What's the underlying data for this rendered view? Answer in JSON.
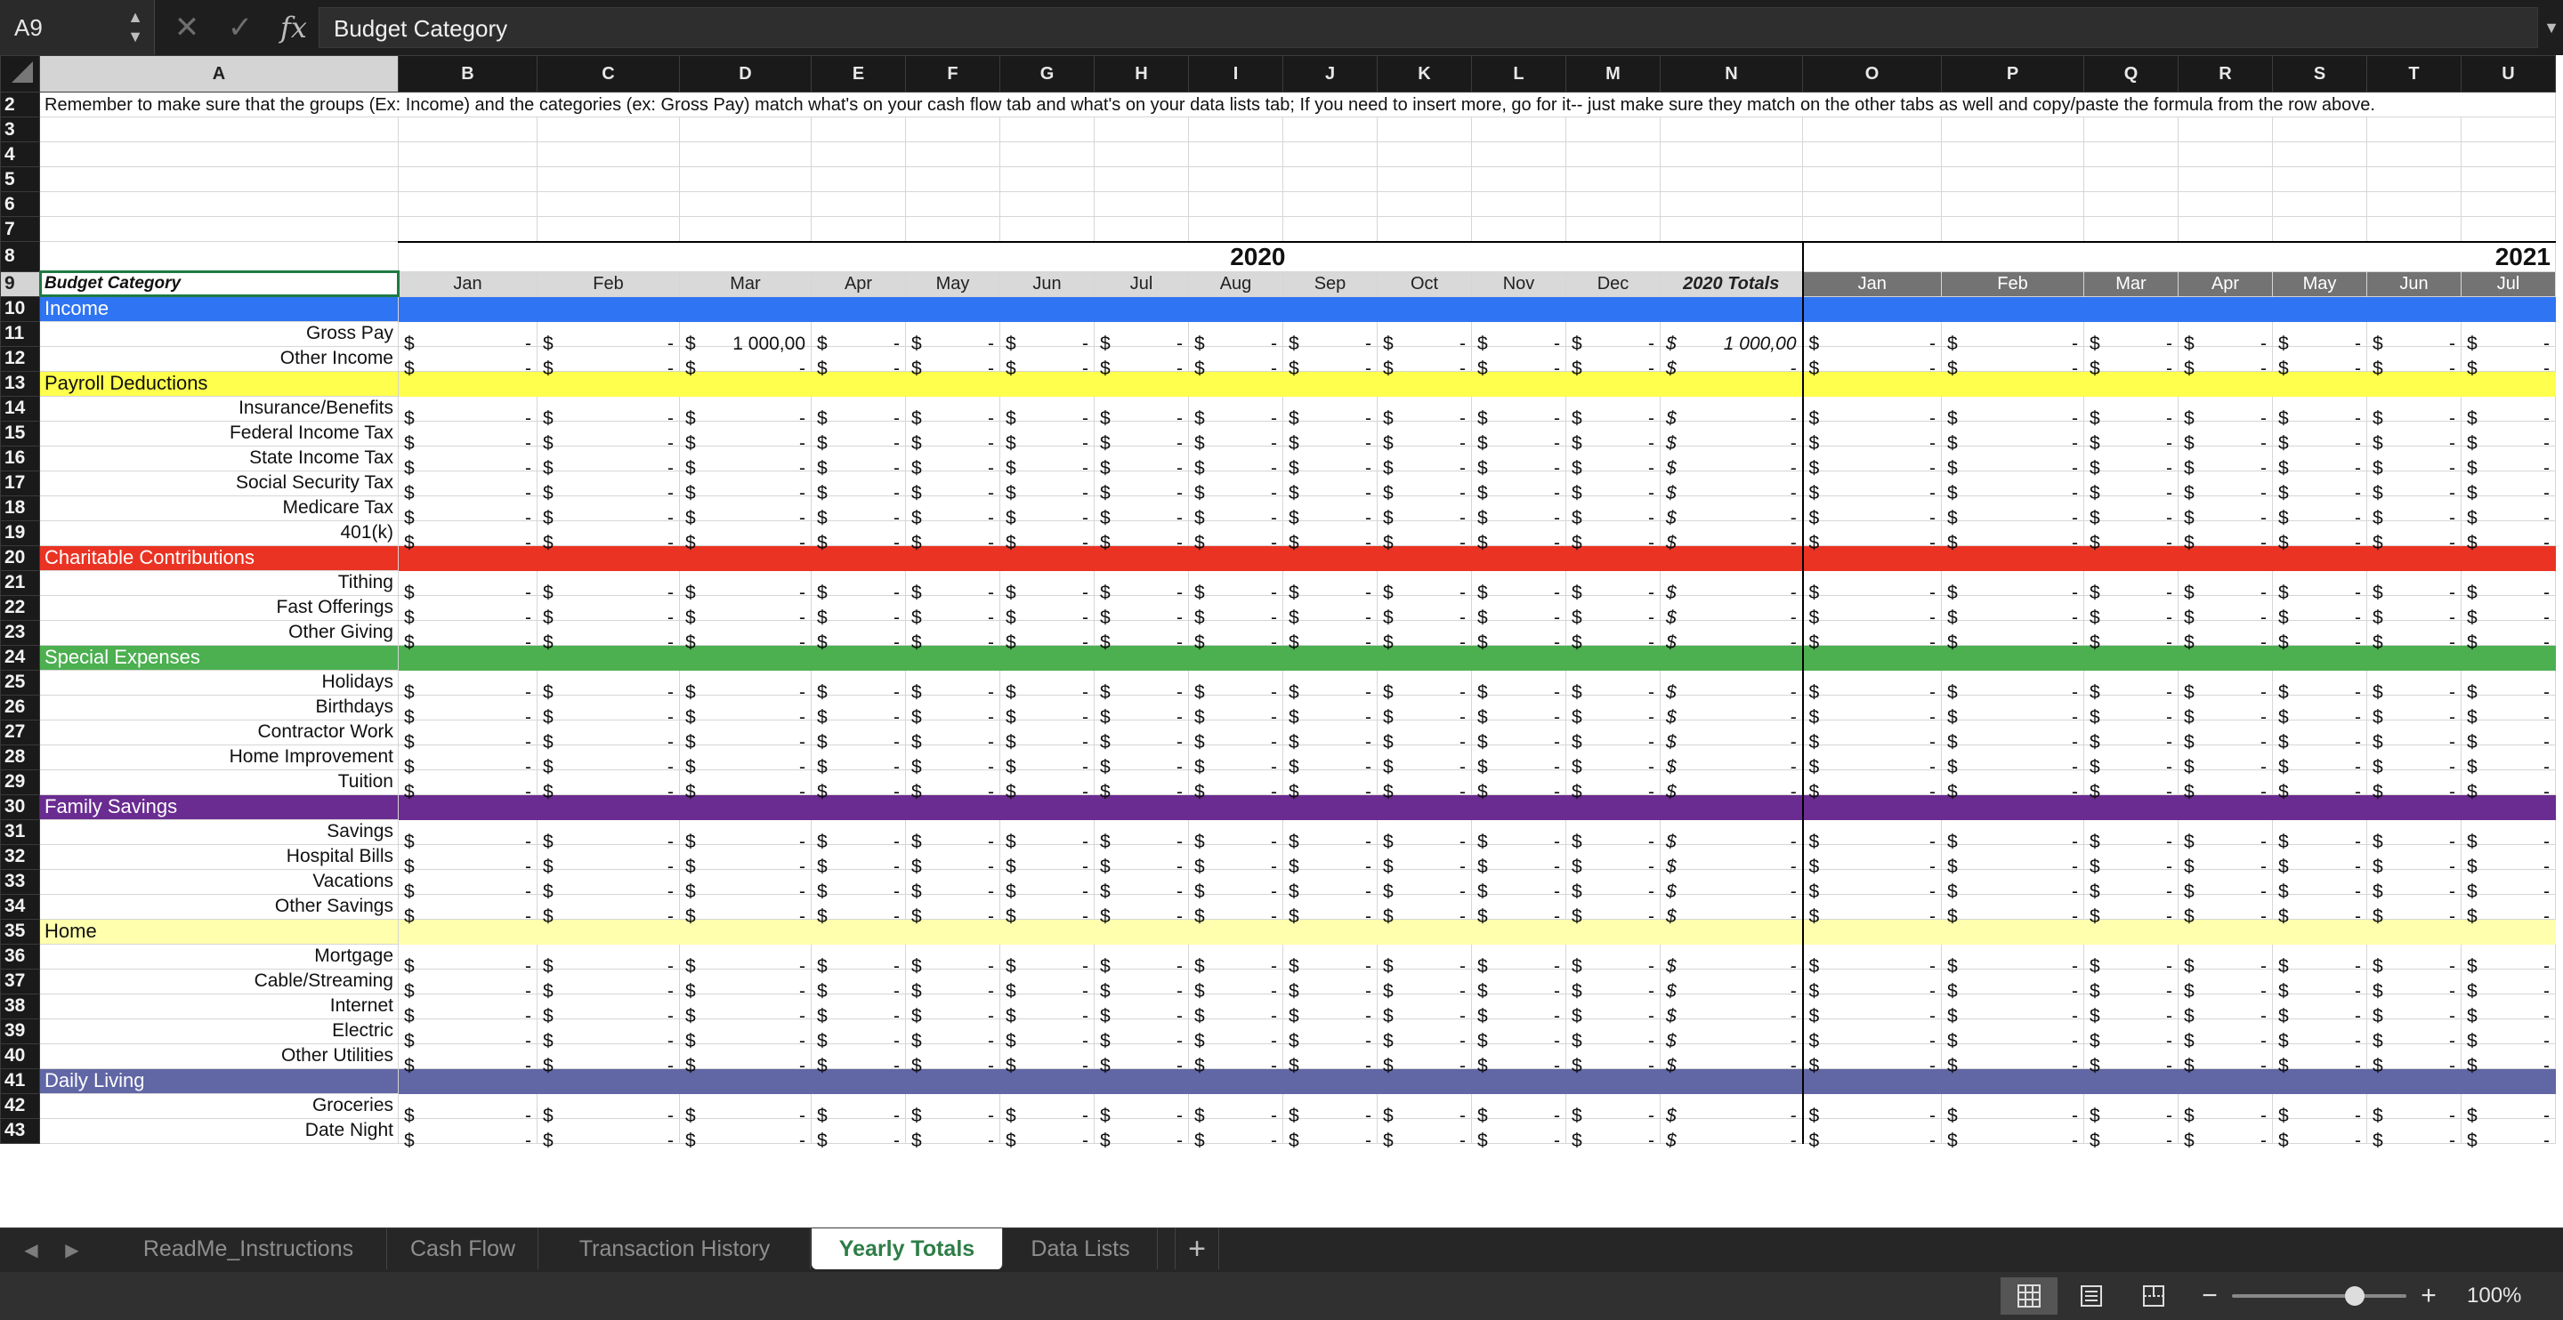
{
  "formula_bar": {
    "name_box": "A9",
    "cancel_glyph": "✕",
    "confirm_glyph": "✓",
    "fx_label": "fx",
    "formula_value": "Budget Category"
  },
  "columns": [
    "A",
    "B",
    "C",
    "D",
    "E",
    "F",
    "G",
    "H",
    "I",
    "J",
    "K",
    "L",
    "M",
    "N",
    "O",
    "P",
    "Q",
    "R",
    "S",
    "T",
    "U"
  ],
  "selected_column": "A",
  "note": "Remember to make sure that the groups (Ex: Income) and the categories (ex: Gross Pay) match what's on your cash flow tab and what's on your data lists tab; If you need to insert more, go for it-- just make sure they match on the other tabs as well and copy/paste the formula from the row above.",
  "years": [
    "2020",
    "2021"
  ],
  "header_row": {
    "budget_label": "Budget Category",
    "months_2020": [
      "Jan",
      "Feb",
      "Mar",
      "Apr",
      "May",
      "Jun",
      "Jul",
      "Aug",
      "Sep",
      "Oct",
      "Nov",
      "Dec"
    ],
    "total_2020": "2020 Totals",
    "months_2021": [
      "Jan",
      "Feb",
      "Mar",
      "Apr",
      "May",
      "Jun",
      "Jul"
    ]
  },
  "currency": "$",
  "empty_value": "-",
  "rows": [
    {
      "row": "2",
      "kind": "note"
    },
    {
      "row": "3",
      "kind": "blank"
    },
    {
      "row": "4",
      "kind": "blank"
    },
    {
      "row": "5",
      "kind": "blank"
    },
    {
      "row": "6",
      "kind": "blank"
    },
    {
      "row": "7",
      "kind": "blank"
    },
    {
      "row": "8",
      "kind": "years"
    },
    {
      "row": "9",
      "kind": "header"
    },
    {
      "row": "10",
      "kind": "category",
      "label": "Income",
      "color": "#2f74f2",
      "text": "#ffffff"
    },
    {
      "row": "11",
      "kind": "item",
      "label": "Gross Pay",
      "values": {
        "D": "1 000,00",
        "N": "1 000,00"
      }
    },
    {
      "row": "12",
      "kind": "item",
      "label": "Other Income"
    },
    {
      "row": "13",
      "kind": "category",
      "label": "Payroll Deductions",
      "color": "#ffff4d",
      "text": "#111111"
    },
    {
      "row": "14",
      "kind": "item",
      "label": "Insurance/Benefits"
    },
    {
      "row": "15",
      "kind": "item",
      "label": "Federal Income Tax"
    },
    {
      "row": "16",
      "kind": "item",
      "label": "State Income Tax"
    },
    {
      "row": "17",
      "kind": "item",
      "label": "Social Security Tax"
    },
    {
      "row": "18",
      "kind": "item",
      "label": "Medicare Tax"
    },
    {
      "row": "19",
      "kind": "item",
      "label": "401(k)"
    },
    {
      "row": "20",
      "kind": "category",
      "label": "Charitable Contributions",
      "color": "#ea3323",
      "text": "#ffffff"
    },
    {
      "row": "21",
      "kind": "item",
      "label": "Tithing"
    },
    {
      "row": "22",
      "kind": "item",
      "label": "Fast Offerings"
    },
    {
      "row": "23",
      "kind": "item",
      "label": "Other Giving"
    },
    {
      "row": "24",
      "kind": "category",
      "label": "Special Expenses",
      "color": "#4caf50",
      "text": "#ffffff"
    },
    {
      "row": "25",
      "kind": "item",
      "label": "Holidays"
    },
    {
      "row": "26",
      "kind": "item",
      "label": "Birthdays"
    },
    {
      "row": "27",
      "kind": "item",
      "label": "Contractor Work"
    },
    {
      "row": "28",
      "kind": "item",
      "label": "Home Improvement"
    },
    {
      "row": "29",
      "kind": "item",
      "label": "Tuition"
    },
    {
      "row": "30",
      "kind": "category",
      "label": "Family Savings",
      "color": "#6a2c91",
      "text": "#ffffff"
    },
    {
      "row": "31",
      "kind": "item",
      "label": "Savings"
    },
    {
      "row": "32",
      "kind": "item",
      "label": "Hospital Bills"
    },
    {
      "row": "33",
      "kind": "item",
      "label": "Vacations"
    },
    {
      "row": "34",
      "kind": "item",
      "label": "Other Savings"
    },
    {
      "row": "35",
      "kind": "category",
      "label": "Home",
      "color": "#ffffad",
      "text": "#111111"
    },
    {
      "row": "36",
      "kind": "item",
      "label": "Mortgage"
    },
    {
      "row": "37",
      "kind": "item",
      "label": "Cable/Streaming"
    },
    {
      "row": "38",
      "kind": "item",
      "label": "Internet"
    },
    {
      "row": "39",
      "kind": "item",
      "label": "Electric"
    },
    {
      "row": "40",
      "kind": "item",
      "label": "Other Utilities"
    },
    {
      "row": "41",
      "kind": "category",
      "label": "Daily Living",
      "color": "#6166a4",
      "text": "#ffffff"
    },
    {
      "row": "42",
      "kind": "item",
      "label": "Groceries"
    },
    {
      "row": "43",
      "kind": "item",
      "label": "Date Night"
    }
  ],
  "sheet_tabs": [
    {
      "label": "ReadMe_Instructions",
      "active": false
    },
    {
      "label": "Cash Flow",
      "active": false
    },
    {
      "label": "Transaction History",
      "active": false
    },
    {
      "label": "Yearly Totals",
      "active": true
    },
    {
      "label": "Data Lists",
      "active": false
    }
  ],
  "add_sheet_glyph": "+",
  "status_bar": {
    "zoom_minus": "−",
    "zoom_plus": "+",
    "zoom_level": "100%",
    "zoom_fraction": 0.5
  },
  "colors": {
    "selection": "#1e7a43",
    "active_tab_text": "#2e7d47"
  }
}
